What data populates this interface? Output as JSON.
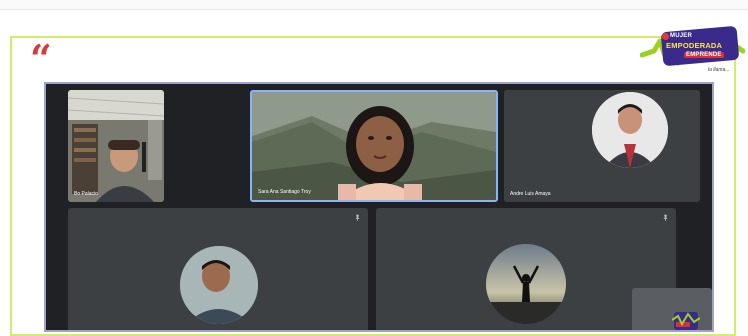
{
  "colors": {
    "frame_border": "#d8ea6a",
    "quote": "#d63a3a",
    "meet_bg": "#202124",
    "tile_bg": "#3c4043",
    "logo_badge": "#3a2a8c"
  },
  "quote_mark": "“",
  "logo": {
    "line1": "MUJER",
    "line2": "EMPODERADA",
    "line3": "EMPRENDE",
    "subtitle": "la llama..."
  },
  "participants": [
    {
      "id": "p1",
      "name": "Bo Palacio",
      "icon": "person-video"
    },
    {
      "id": "p2",
      "name": "Sara Ana Santiago Troy",
      "icon": "person-video"
    },
    {
      "id": "p3",
      "name": "Andre Luis Amaya",
      "icon": "avatar-photo"
    },
    {
      "id": "p4",
      "name": "",
      "icon": "avatar-photo"
    },
    {
      "id": "p5",
      "name": "",
      "icon": "avatar-photo"
    }
  ],
  "icons": [
    "pin-icon",
    "pin-icon"
  ]
}
